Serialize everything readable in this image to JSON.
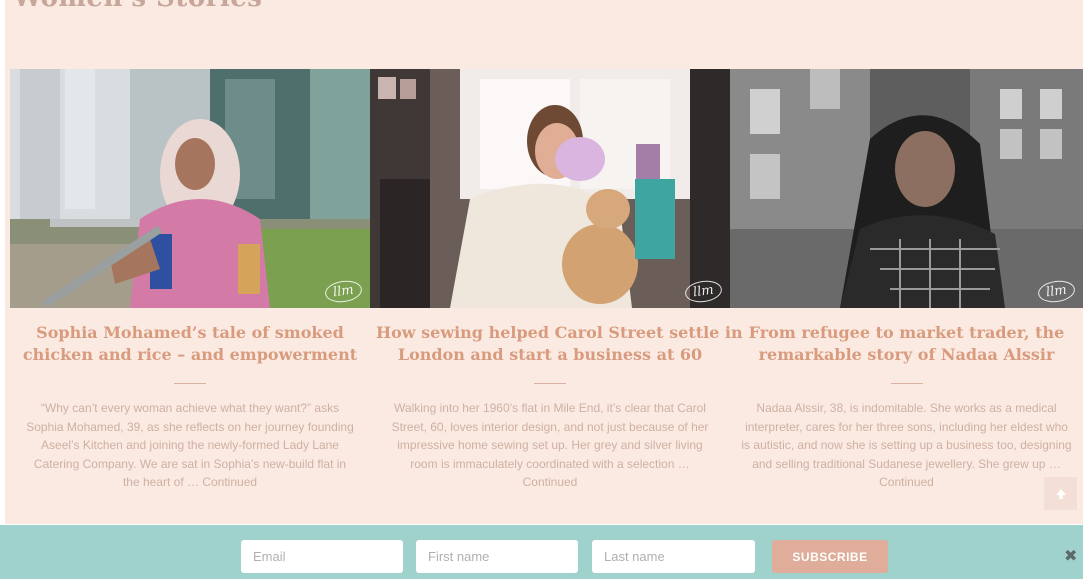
{
  "section": {
    "heading": "Women's Stories"
  },
  "cards": [
    {
      "title_lines": [
        "Sophia Mohamed’s tale of smoked",
        "chicken and rice – and empowerment"
      ],
      "excerpt_lines": [
        "“Why can’t every woman achieve what they want?” asks",
        "Sophia Mohamed, 39, as she reflects on her journey founding",
        "Aseel’s Kitchen and joining the newly-formed Lady Lane",
        "Catering Company. We are sat in Sophia’s new-build flat in",
        "the heart of …"
      ],
      "continued_label": "Continued",
      "watermark": "llm"
    },
    {
      "title_lines": [
        "How sewing helped Carol Street settle in",
        "London and start a business at 60"
      ],
      "excerpt_lines": [
        "Walking into her 1960’s flat in Mile End, it’s clear that Carol",
        "Street, 60, loves interior design, and not just because of her",
        "impressive home sewing set up. Her grey and silver living",
        "room is immaculately coordinated with a selection …",
        ""
      ],
      "continued_label": "Continued",
      "watermark": "llm"
    },
    {
      "title_lines": [
        "From refugee to market trader, the",
        "remarkable story of Nadaa Alssir"
      ],
      "excerpt_lines": [
        "Nadaa Alssir, 38, is indomitable. She works as a medical",
        "interpreter, cares for her three sons, including her eldest who",
        "is autistic, and now she is setting up a business too, designing",
        "and selling traditional Sudanese jewellery. She grew up …",
        ""
      ],
      "continued_label": "Continued",
      "watermark": "llm"
    }
  ],
  "back_to_top": {
    "icon": "arrow-up-icon"
  },
  "subscribe_bar": {
    "email_placeholder": "Email",
    "first_name_placeholder": "First name",
    "last_name_placeholder": "Last name",
    "subscribe_label": "SUBSCRIBE",
    "close_label": "✖"
  },
  "colors": {
    "section_bg": "#faeae2",
    "title": "#d99b7e",
    "excerpt": "#cfb0a2",
    "bar_bg": "#9fd1cd",
    "subscribe_bg": "#dfad99"
  }
}
